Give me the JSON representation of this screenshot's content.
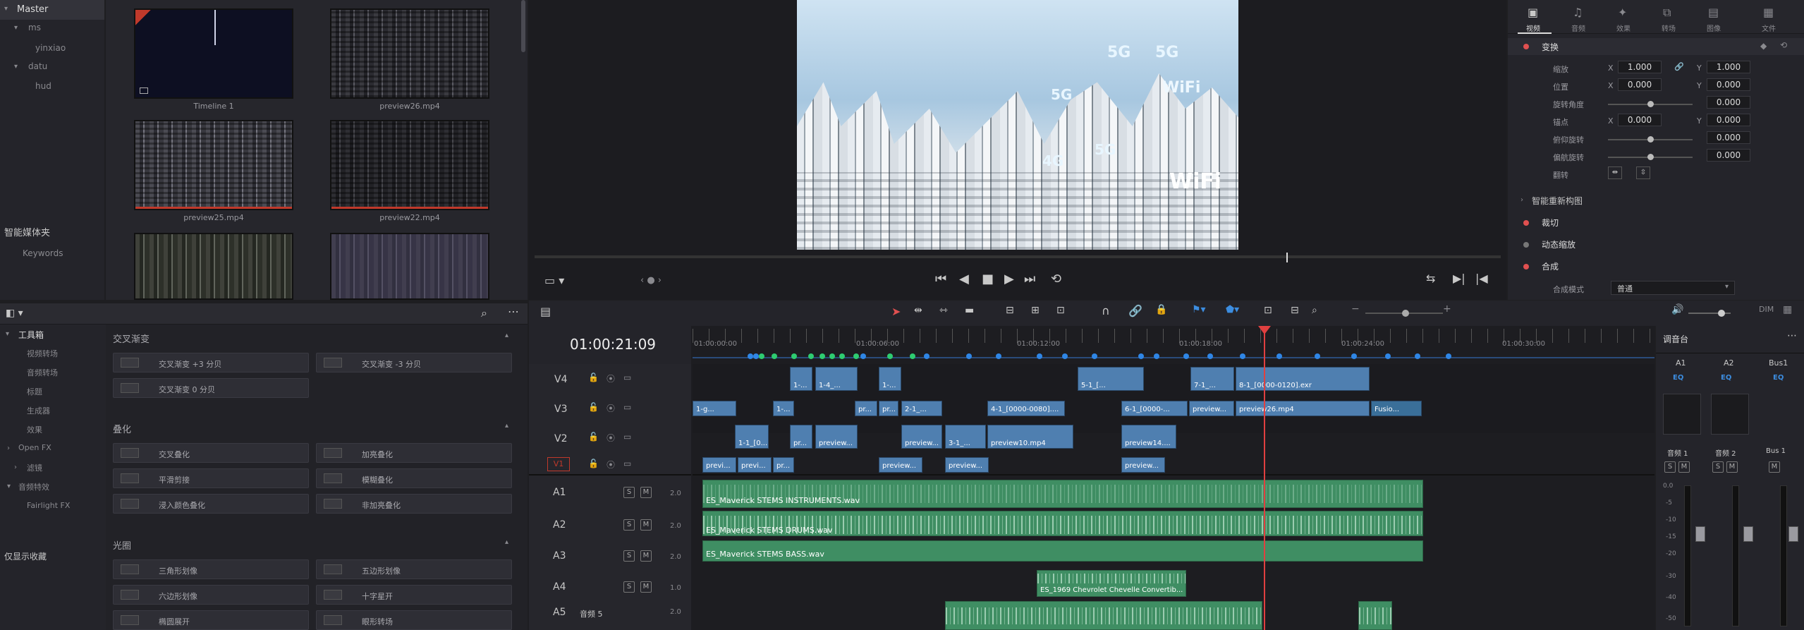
{
  "media_tree": {
    "root": "Master",
    "items": [
      "ms",
      "yinxiao",
      "datu",
      "hud"
    ],
    "smart_bins_title": "智能媒体夹",
    "smart_bins_item": "Keywords"
  },
  "media_pool": {
    "clips": [
      {
        "name": "Timeline 1"
      },
      {
        "name": "preview26.mp4"
      },
      {
        "name": "preview25.mp4"
      },
      {
        "name": "preview22.mp4"
      }
    ]
  },
  "effects": {
    "toolbox_title": "工具箱",
    "tree": [
      "视频转场",
      "音频转场",
      "标题",
      "生成器",
      "效果",
      "Open FX",
      "滤镜",
      "音频特效",
      "Fairlight FX"
    ],
    "favorites_title": "仅显示收藏",
    "sections": [
      {
        "title": "交叉渐变",
        "items": [
          "交叉渐变 +3 分贝",
          "交叉渐变 -3 分贝",
          "交叉渐变 0 分贝"
        ]
      },
      {
        "title": "叠化",
        "items": [
          "交叉叠化",
          "加亮叠化",
          "平滑剪接",
          "模糊叠化",
          "浸入颜色叠化",
          "非加亮叠化"
        ]
      },
      {
        "title": "光圈",
        "items": [
          "三角形划像",
          "五边形划像",
          "六边形划像",
          "十字星开",
          "椭圆展开",
          "眼形转场"
        ]
      }
    ]
  },
  "timeline": {
    "timecode": "01:00:21:09",
    "ruler": [
      "01:00:00:00",
      "01:00:06:00",
      "01:00:12:00",
      "01:00:18:00",
      "01:00:24:00",
      "01:00:30:00"
    ],
    "video_tracks": [
      "V4",
      "V3",
      "V2",
      "V1"
    ],
    "audio_tracks": [
      {
        "id": "A1",
        "vol": "2.0",
        "clip": "ES_Maverick STEMS INSTRUMENTS.wav"
      },
      {
        "id": "A2",
        "vol": "2.0",
        "clip": "ES_Maverick STEMS DRUMS.wav"
      },
      {
        "id": "A3",
        "vol": "2.0",
        "clip": "ES_Maverick STEMS BASS.wav"
      },
      {
        "id": "A4",
        "vol": "1.0",
        "clip": "ES_1969 Chevrolet Chevelle Convertib..."
      },
      {
        "id": "A5",
        "vol": "2.0",
        "name": "音频 5"
      }
    ],
    "clips": {
      "v4": [
        "1-...",
        "1-4_...",
        "1-...",
        "5-1_[...",
        "7-1_...",
        "8-1_[0000-0120].exr"
      ],
      "v3": [
        "1-g...",
        "1-...",
        "pr...",
        "pr...",
        "2-1_...",
        "4-1_[0000-0080]....",
        "6-1_[0000-...",
        "preview...",
        "preview26.mp4",
        "Fusio..."
      ],
      "v2": [
        "1-1_[0...",
        "pr...",
        "preview...",
        "preview...",
        "3-1_...",
        "preview10.mp4",
        "preview14...."
      ],
      "v1": [
        "previ...",
        "previ...",
        "pr...",
        "preview...",
        "preview...",
        "preview..."
      ]
    }
  },
  "mixer": {
    "title": "调音台",
    "channels": [
      "A1",
      "A2",
      "Bus1"
    ],
    "labels": [
      "音频 1",
      "音频 2",
      "Bus 1"
    ],
    "eq": "EQ",
    "scale": [
      "0.0",
      "-5",
      "-10",
      "-15",
      "-20",
      "-30",
      "-40",
      "-50"
    ]
  },
  "inspector": {
    "tabs": [
      "视频",
      "音频",
      "效果",
      "转场",
      "图像",
      "文件"
    ],
    "transform": "变换",
    "rows": [
      {
        "label": "缩放",
        "x": "1.000",
        "y": "1.000"
      },
      {
        "label": "位置",
        "x": "0.000",
        "y": "0.000"
      },
      {
        "label": "旋转角度",
        "v": "0.000"
      },
      {
        "label": "锚点",
        "x": "0.000",
        "y": "0.000"
      },
      {
        "label": "俯仰旋转",
        "v": "0.000"
      },
      {
        "label": "偏航旋转",
        "v": "0.000"
      },
      {
        "label": "翻转"
      }
    ],
    "sections": [
      "智能重新构图",
      "裁切",
      "动态缩放",
      "合成"
    ],
    "blend_label": "合成模式",
    "blend_value": "普通"
  },
  "viewer": {
    "overlay_text": [
      "5G",
      "5G",
      "WiFi",
      "4G",
      "5G",
      "WiFi",
      "5G"
    ]
  }
}
